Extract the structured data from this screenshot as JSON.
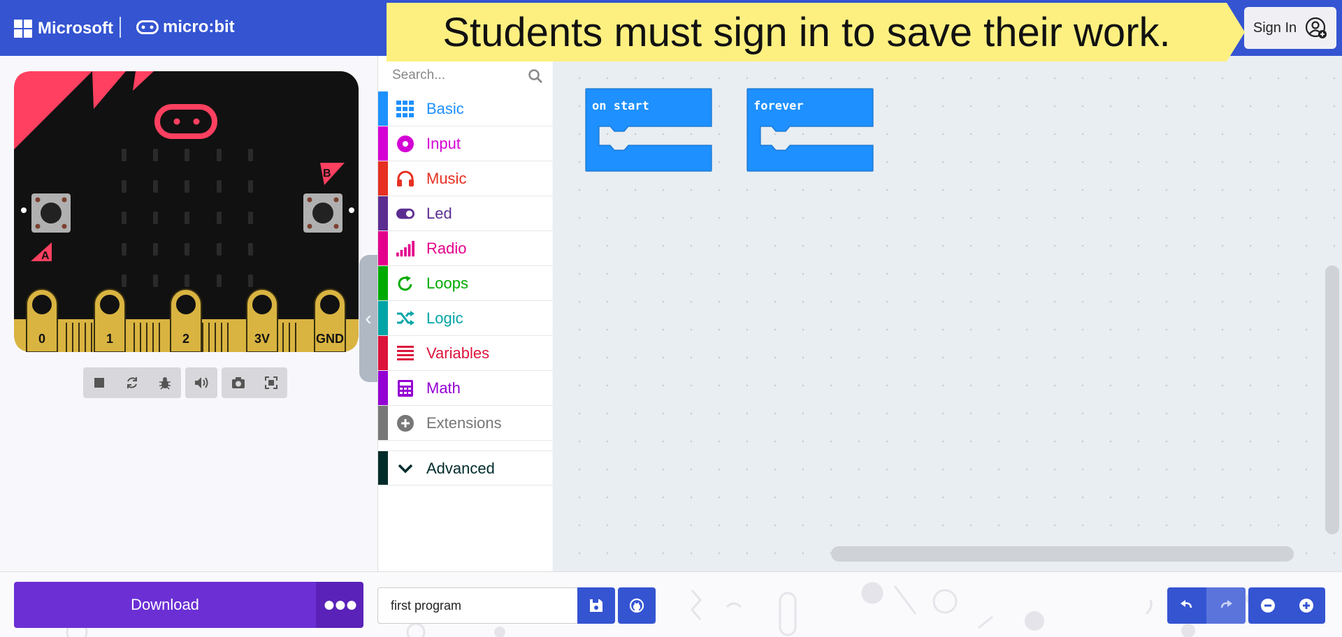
{
  "header": {
    "brand": "Microsoft",
    "product": "micro:bit",
    "banner_text": "Students must sign in to save their work.",
    "sign_in_label": "Sign In"
  },
  "simulator": {
    "pins": [
      "0",
      "1",
      "2",
      "3V",
      "GND"
    ],
    "button_a": "A",
    "button_b": "B",
    "controls": [
      "stop-icon",
      "restart-icon",
      "debug-icon",
      "mute-icon",
      "screenshot-icon",
      "fullscreen-icon"
    ]
  },
  "toolbox": {
    "search_placeholder": "Search...",
    "categories": [
      {
        "label": "Basic",
        "color": "#1e90ff",
        "icon": "grid-icon"
      },
      {
        "label": "Input",
        "color": "#d400d4",
        "icon": "target-icon"
      },
      {
        "label": "Music",
        "color": "#e63022",
        "icon": "headphones-icon"
      },
      {
        "label": "Led",
        "color": "#5c2d91",
        "icon": "toggle-icon"
      },
      {
        "label": "Radio",
        "color": "#e3008c",
        "icon": "signal-bars-icon"
      },
      {
        "label": "Loops",
        "color": "#00aa00",
        "icon": "loop-icon"
      },
      {
        "label": "Logic",
        "color": "#00a4a6",
        "icon": "shuffle-icon"
      },
      {
        "label": "Variables",
        "color": "#dc143c",
        "icon": "lines-icon"
      },
      {
        "label": "Math",
        "color": "#9400d3",
        "icon": "calculator-icon"
      },
      {
        "label": "Extensions",
        "color": "#777777",
        "icon": "plus-circle-icon"
      }
    ],
    "advanced_label": "Advanced",
    "advanced_color": "#002b2b"
  },
  "workspace": {
    "blocks": [
      {
        "label": "on start"
      },
      {
        "label": "forever"
      }
    ]
  },
  "bottom": {
    "download_label": "Download",
    "project_name": "first program"
  }
}
